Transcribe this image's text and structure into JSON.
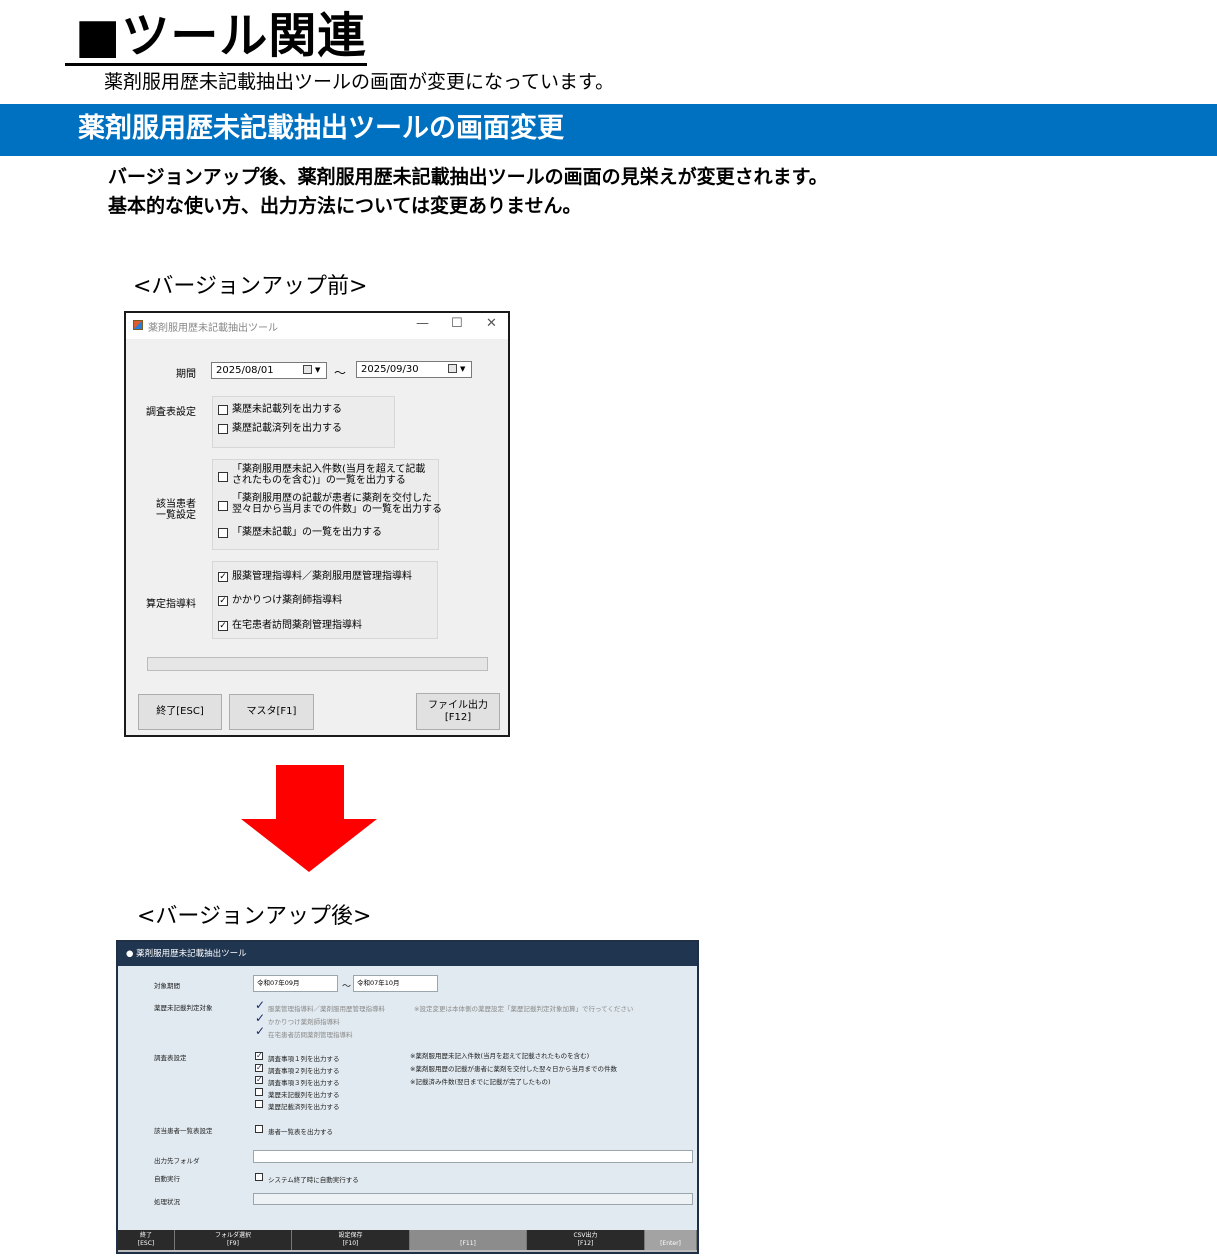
{
  "header": {
    "title": "■ツール関連",
    "subtitle": "薬剤服用歴未記載抽出ツールの画面が変更になっています。"
  },
  "section": {
    "heading": "薬剤服用歴未記載抽出ツールの画面変更",
    "desc_line1": "バージョンアップ後、薬剤服用歴未記載抽出ツールの画面の見栄えが変更されます。",
    "desc_line2": "基本的な使い方、出力方法については変更ありません。",
    "caption_before": "<バージョンアップ前>",
    "caption_after": "<バージョンアップ後>"
  },
  "old_window": {
    "title": "薬剤服用歴未記載抽出ツール",
    "minimize": "—",
    "maximize": "☐",
    "close": "✕",
    "period_label": "期間",
    "date_from": "2025/08/01",
    "tilde": "～",
    "date_to": "2025/09/30",
    "survey_label": "調査表設定",
    "survey_opts": [
      "薬歴未記載列を出力する",
      "薬歴記載済列を出力する"
    ],
    "patients_label_1": "該当患者",
    "patients_label_2": "一覧設定",
    "patient_opt1_a": "「薬剤服用歴未記入件数(当月を超えて記載",
    "patient_opt1_b": "されたものを含む)」の一覧を出力する",
    "patient_opt2_a": "「薬剤服用歴の記載が患者に薬剤を交付した",
    "patient_opt2_b": "翌々日から当月までの件数」の一覧を出力する",
    "patient_opt3": "「薬歴未記載」の一覧を出力する",
    "calc_label": "算定指導料",
    "calc_opts": [
      "服薬管理指導料／薬剤服用歴管理指導料",
      "かかりつけ薬剤師指導料",
      "在宅患者訪問薬剤管理指導料"
    ],
    "check_mark": "✓",
    "btn_exit": "終了[ESC]",
    "btn_master": "マスタ[F1]",
    "btn_file_1": "ファイル出力",
    "btn_file_2": "[F12]"
  },
  "new_window": {
    "title": "● 薬剤服用歴未記載抽出ツール",
    "period_label": "対象期間",
    "date_from": "令和07年09月",
    "tilde": "～",
    "date_to": "令和07年10月",
    "judge_label": "薬歴未記載判定対象",
    "judge_opts": [
      "服薬管理指導料／薬剤服用歴管理指導料",
      "かかりつけ薬剤師指導料",
      "在宅患者訪問薬剤管理指導料"
    ],
    "judge_note": "※設定変更は本体側の薬歴設定「薬歴記載判定対象加算」で行ってください",
    "survey_label": "調査表設定",
    "survey_opts": [
      "調査事項１列を出力する",
      "調査事項２列を出力する",
      "調査事項３列を出力する",
      "薬歴未記載列を出力する",
      "薬歴記載済列を出力する"
    ],
    "survey_notes": [
      "※薬剤服用歴未記入件数(当月を超えて記載されたものを含む)",
      "※薬剤服用歴の記載が患者に薬剤を交付した翌々日から当月までの件数",
      "※記載済み件数(翌日までに記載が完了したもの)"
    ],
    "patients_label": "該当患者一覧表設定",
    "patients_opt": "患者一覧表を出力する",
    "output_label": "出力先フォルダ",
    "auto_label": "自動実行",
    "auto_opt": "システム終了時に自動実行する",
    "status_label": "処理状況",
    "tick": "✓",
    "keys": [
      {
        "label": "終了",
        "key": "[ESC]"
      },
      {
        "label": "フォルダ選択",
        "key": "[F9]"
      },
      {
        "label": "設定保存",
        "key": "[F10]"
      },
      {
        "label": "",
        "key": "[F11]"
      },
      {
        "label": "CSV出力",
        "key": "[F12]"
      },
      {
        "label": "",
        "key": "[Enter]"
      }
    ]
  }
}
